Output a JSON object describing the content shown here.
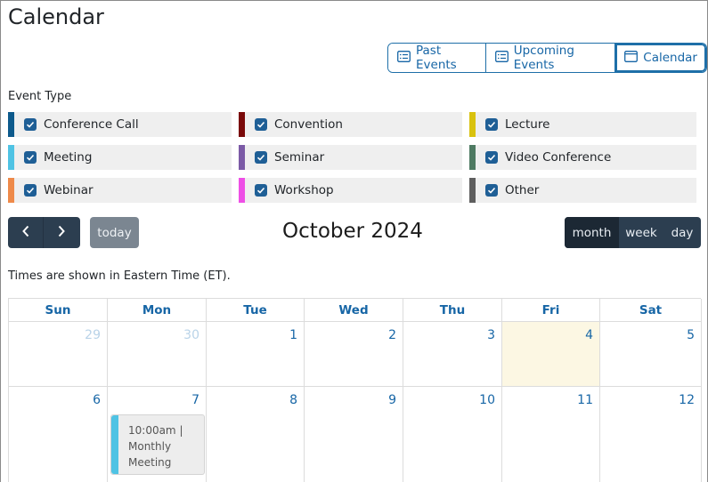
{
  "page": {
    "title": "Calendar"
  },
  "view_toggle": {
    "past_label": "Past Events",
    "upcoming_label": "Upcoming Events",
    "calendar_label": "Calendar"
  },
  "filters": {
    "heading": "Event Type",
    "items": [
      {
        "label": "Conference Call",
        "color": "#0d5a8c",
        "checked": true
      },
      {
        "label": "Convention",
        "color": "#7a0a0a",
        "checked": true
      },
      {
        "label": "Lecture",
        "color": "#d9c20f",
        "checked": true
      },
      {
        "label": "Meeting",
        "color": "#4fc3e4",
        "checked": true
      },
      {
        "label": "Seminar",
        "color": "#7b5aa6",
        "checked": true
      },
      {
        "label": "Video Conference",
        "color": "#4e7a62",
        "checked": true
      },
      {
        "label": "Webinar",
        "color": "#ee8a4a",
        "checked": true
      },
      {
        "label": "Workshop",
        "color": "#ee4fe6",
        "checked": true
      },
      {
        "label": "Other",
        "color": "#5e5e5e",
        "checked": true
      }
    ]
  },
  "toolbar": {
    "prev_icon": "chevron-left-icon",
    "next_icon": "chevron-right-icon",
    "today_label": "today",
    "title": "October 2024",
    "month_label": "month",
    "week_label": "week",
    "day_label": "day",
    "active_view": "month"
  },
  "timezone_note": "Times are shown in Eastern Time (ET).",
  "calendar": {
    "weekdays": [
      "Sun",
      "Mon",
      "Tue",
      "Wed",
      "Thu",
      "Fri",
      "Sat"
    ],
    "weeks": [
      [
        "29",
        "30",
        "1",
        "2",
        "3",
        "4",
        "5"
      ],
      [
        "6",
        "7",
        "8",
        "9",
        "10",
        "11",
        "12"
      ]
    ],
    "other_month_days": [
      "29",
      "30"
    ],
    "today": "4",
    "events": [
      {
        "day": "7",
        "text_line1": "10:00am |",
        "text_line2": "Monthly",
        "text_line3": "Meeting",
        "type_color": "#4fc3e4"
      }
    ]
  },
  "colors": {
    "accent": "#1766a6",
    "toolbar_dark": "#2c3e50",
    "today_bg": "#fcf7e3"
  }
}
